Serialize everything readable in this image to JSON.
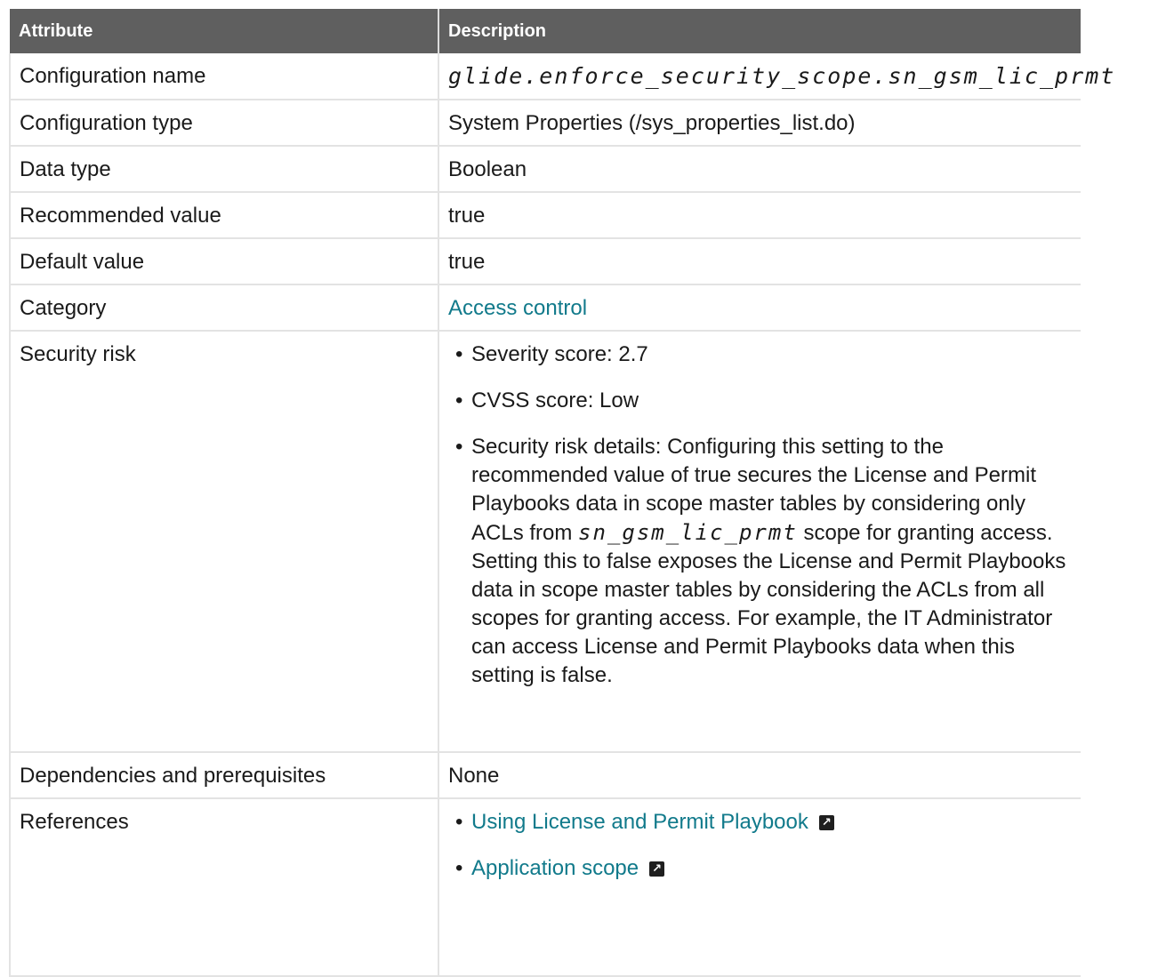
{
  "table": {
    "headers": {
      "attribute": "Attribute",
      "description": "Description"
    },
    "rows": {
      "config_name": {
        "label": "Configuration name",
        "value": "glide.enforce_security_scope.sn_gsm_lic_prmt"
      },
      "config_type": {
        "label": "Configuration type",
        "value": "System Properties (/sys_properties_list.do)"
      },
      "data_type": {
        "label": "Data type",
        "value": "Boolean"
      },
      "recommended": {
        "label": "Recommended value",
        "value": "true"
      },
      "default": {
        "label": "Default value",
        "value": "true"
      },
      "category": {
        "label": "Category",
        "value": "Access control"
      },
      "security_risk": {
        "label": "Security risk",
        "severity": "Severity score: 2.7",
        "cvss": "CVSS score: Low",
        "details_before": "Security risk details: Configuring this setting to the recommended value of true secures the License and Permit Playbooks data in scope master tables by considering only ACLs from ",
        "details_scope": "sn_gsm_lic_prmt",
        "details_after": " scope for granting access. Setting this to false exposes the License and Permit Playbooks data in scope master tables by considering the ACLs from all scopes for granting access. For example, the IT Administrator can access License and Permit Playbooks data when this setting is false."
      },
      "dependencies": {
        "label": "Dependencies and prerequisites",
        "value": "None"
      },
      "references": {
        "label": "References",
        "links": [
          "Using License and Permit Playbook",
          "Application scope"
        ]
      }
    }
  },
  "colors": {
    "header_bg": "#5f5f5f",
    "link": "#117a8b",
    "border": "#e3e3e3"
  },
  "icons": {
    "external_link": "external-link-icon"
  }
}
